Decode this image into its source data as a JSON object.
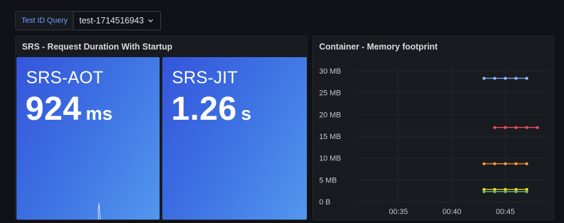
{
  "variables": {
    "label": "Test ID Query",
    "value": "test-1714516943",
    "dropdown_icon": "chevron-down-icon"
  },
  "left_panel": {
    "title": "SRS - Request Duration With Startup",
    "stats": [
      {
        "name": "SRS-AOT",
        "value": "924",
        "unit": "ms"
      },
      {
        "name": "SRS-JIT",
        "value": "1.26",
        "unit": "s"
      }
    ]
  },
  "right_panel": {
    "title": "Container - Memory footprint"
  },
  "colors": {
    "background": "#111217",
    "panel": "#181b1f",
    "stat_blue": "#3d70e2",
    "series_blue": "#8ab8ff",
    "series_red": "#f2495c",
    "series_orange": "#ff9830",
    "series_yellow": "#fade2a",
    "series_green": "#73bf69"
  },
  "chart_data": {
    "type": "line",
    "title": "Container - Memory footprint",
    "xlabel": "",
    "ylabel": "",
    "ylim": [
      0,
      30
    ],
    "yunit": "MB",
    "y_ticks": [
      "0 B",
      "5 MB",
      "10 MB",
      "15 MB",
      "20 MB",
      "25 MB",
      "30 MB"
    ],
    "y_tick_values": [
      0,
      5,
      10,
      15,
      20,
      25,
      30
    ],
    "x_ticks": [
      "00:35",
      "00:40",
      "00:45"
    ],
    "grid": true,
    "legend": "none",
    "series": [
      {
        "color": "#8ab8ff",
        "x": [
          "00:43",
          "00:44",
          "00:45",
          "00:46",
          "00:47"
        ],
        "values": [
          28.3,
          28.3,
          28.3,
          28.3,
          28.3
        ]
      },
      {
        "color": "#f2495c",
        "x": [
          "00:44",
          "00:45",
          "00:46",
          "00:47",
          "00:48"
        ],
        "values": [
          17.0,
          17.0,
          17.0,
          17.0,
          17.0
        ]
      },
      {
        "color": "#ff9830",
        "x": [
          "00:43",
          "00:44",
          "00:45",
          "00:46",
          "00:47"
        ],
        "values": [
          8.7,
          8.7,
          8.7,
          8.7,
          8.7
        ]
      },
      {
        "color": "#fade2a",
        "x": [
          "00:43",
          "00:44",
          "00:45",
          "00:46",
          "00:47"
        ],
        "values": [
          2.8,
          2.8,
          2.8,
          2.8,
          2.8
        ]
      },
      {
        "color": "#73bf69",
        "x": [
          "00:43",
          "00:44",
          "00:45",
          "00:46",
          "00:47"
        ],
        "values": [
          2.3,
          2.3,
          2.3,
          2.3,
          2.3
        ]
      }
    ]
  }
}
